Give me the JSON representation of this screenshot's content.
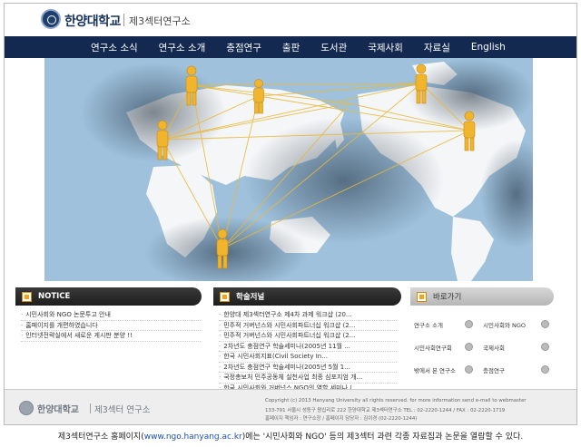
{
  "header": {
    "university": "한양대학교",
    "institute": "제3섹터연구소"
  },
  "nav": [
    "연구소 소식",
    "연구소 소개",
    "충점연구",
    "출판",
    "도서관",
    "국제사회",
    "자료실",
    "English"
  ],
  "panels": {
    "notice": {
      "title": "NOTICE",
      "items": [
        "시민사회와 NGO 논문투고 안내",
        "홈페이지를 개편하였습니다",
        "인터넷전략실에서 새로운 게시판 분양 !!"
      ]
    },
    "journal": {
      "title": "학술저널",
      "items": [
        "한양대 제3섹터연구소 제4차 과제 워크샵 (20...",
        "민주적 거버넌스와 시민사회파트너십 워크샵 (2...",
        "민주적 거버넌스와 시민사회파트너십 워크샵 (2...",
        "2차년도 충점연구 학술세미나(2005년 11월 ...",
        "한국 시민사회지표(Civil Society In...",
        "2차년도 충점연구 학술세미나(2005년 5월 1...",
        "국정총보처 민주공동체 실천사업 최종 심포지엄 개...",
        "한국 시민사회와 거버넌스 NGO의 역할 세미나 (..."
      ]
    },
    "quick": {
      "title": "바로가기",
      "items": [
        "연구소 소개",
        "시민사회와 NGO",
        "시민사회연구회",
        "국제사회",
        "밖에서 본 연구소",
        "충점연구"
      ]
    }
  },
  "footer": {
    "university": "한양대학교",
    "institute": "제3섹터 연구소",
    "copyright": "Copyright (c) 2013 Hanyang University all rights reserved. for more information send e-mail to webmaster",
    "address": "133-791 서울시 성동구 왕십리로 222 한양대학교 제3섹터연구소 TEL : 02-2220-1244 / FAX : 02-2220-1719",
    "manager": "홈페이지 책임자 : 연구소장 / 홈페이지 담당자 : 김이경 (02-2220-1244)"
  },
  "caption": {
    "before": "제3섹터연구소 홈페이지(",
    "link": "www.ngo.hanyang.ac.kr",
    "after": ")에는 '시민사회와 NGO' 등의 제3섹터 과련 각종 자료집과 논문을 열람할 수 있다."
  },
  "colors": {
    "nav_bg": "#14294f",
    "accent": "#f2a21b",
    "ocean": "#a9c8e0",
    "land": "#f4f6f8"
  }
}
